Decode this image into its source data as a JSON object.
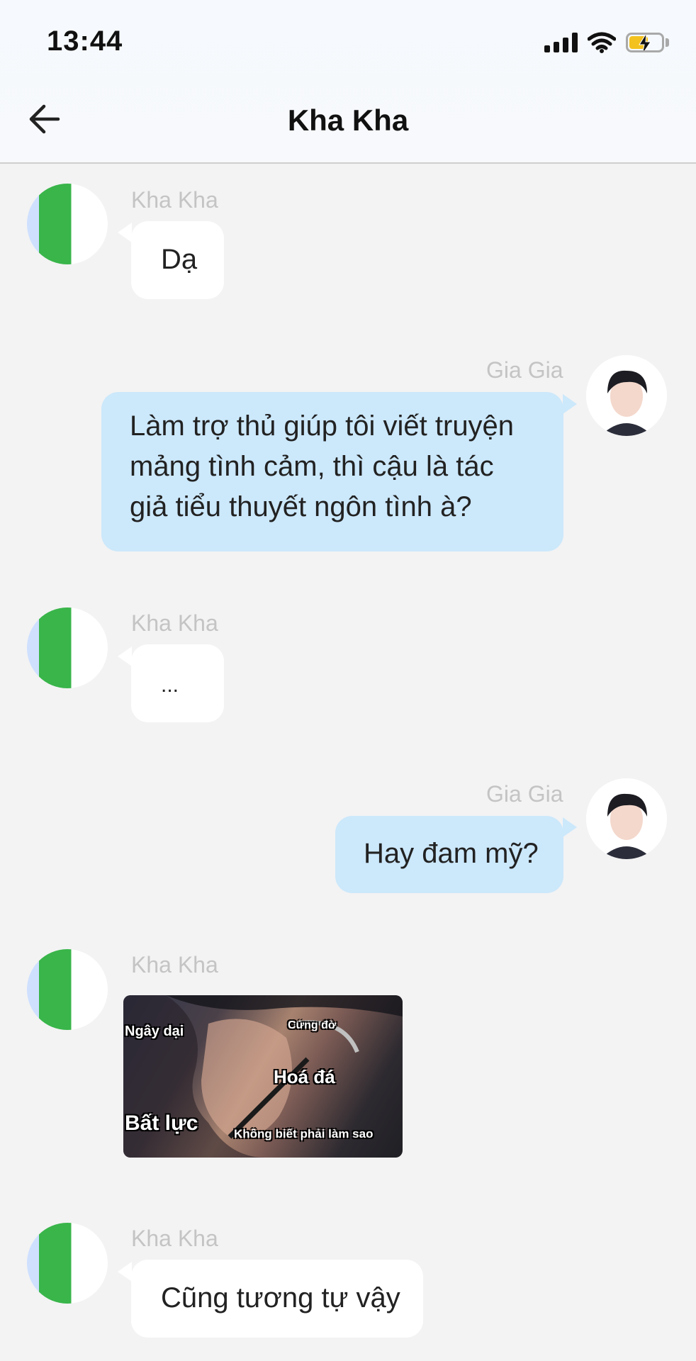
{
  "status_bar": {
    "time": "13:44",
    "icons": [
      "signal-icon",
      "wifi-icon",
      "battery-charging-icon"
    ],
    "battery_color": "#f4c21f"
  },
  "header": {
    "title": "Kha Kha",
    "back_icon": "arrow-left-icon"
  },
  "messages": [
    {
      "sender": "Kha Kha",
      "direction": "incoming",
      "text": "Dạ"
    },
    {
      "sender": "Gia Gia",
      "direction": "outgoing",
      "lines": [
        "Làm trợ thủ giúp tôi viết truyện",
        "mảng tình cảm, thì cậu là tác",
        "giả tiểu thuyết ngôn tình à?"
      ]
    },
    {
      "sender": "Kha Kha",
      "direction": "incoming",
      "text": "..."
    },
    {
      "sender": "Gia Gia",
      "direction": "outgoing",
      "text": "Hay đam mỹ?"
    },
    {
      "sender": "Kha Kha",
      "direction": "incoming",
      "type": "sticker",
      "sticker_texts": [
        "Ngây dại",
        "Cứng đờ",
        "Hoá đá",
        "Bất lực",
        "Không biết phải làm sao"
      ]
    },
    {
      "sender": "Kha Kha",
      "direction": "incoming",
      "text": "Cũng tương tự vậy"
    }
  ],
  "colors": {
    "incoming_bubble": "#ffffff",
    "outgoing_bubble": "#cce8fb",
    "background": "#f3f3f3"
  }
}
